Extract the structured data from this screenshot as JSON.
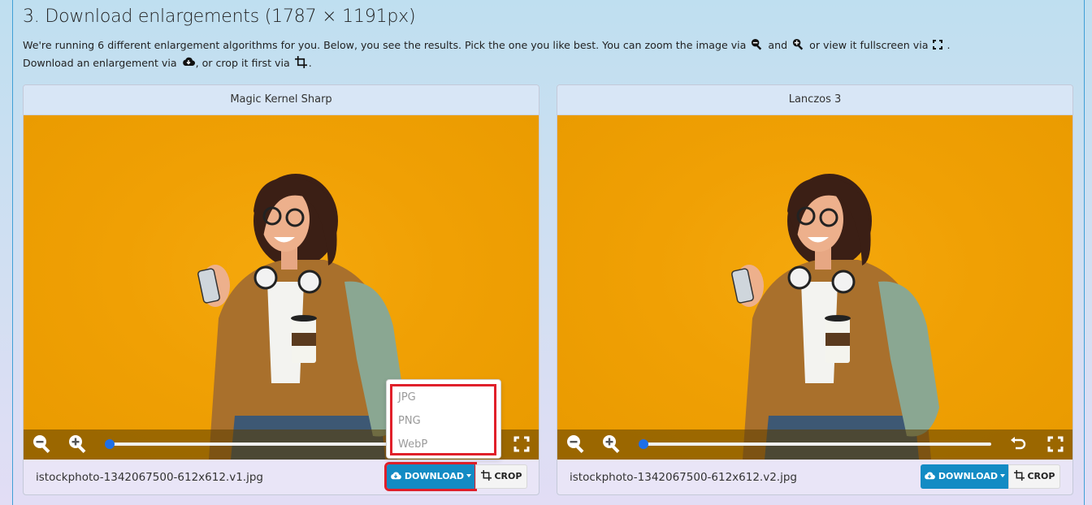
{
  "header": {
    "title": "3. Download enlargements (1787 × 1191px)",
    "desc_1": "We're running 6 different enlargement algorithms for you. Below, you see the results. Pick the one you like best. You can zoom the image via",
    "desc_and": "and",
    "desc_2": "or view it fullscreen via",
    "desc_dot": ".",
    "desc_3": "Download an enlargement via",
    "desc_4": ", or crop it first via",
    "desc_end": "."
  },
  "cards": [
    {
      "title": "Magic Kernel Sharp",
      "filename": "istockphoto-1342067500-612x612.v1.jpg",
      "download_label": "DOWNLOAD",
      "crop_label": "CROP"
    },
    {
      "title": "Lanczos 3",
      "filename": "istockphoto-1342067500-612x612.v2.jpg",
      "download_label": "DOWNLOAD",
      "crop_label": "CROP"
    }
  ],
  "dropdown": {
    "options": [
      "JPG",
      "PNG",
      "WebP"
    ]
  },
  "icons": {
    "zoom_out": "zoom-out-icon",
    "zoom_in": "zoom-in-icon",
    "fullscreen": "fullscreen-icon",
    "reset": "undo-icon",
    "cloud": "cloud-download-icon",
    "crop": "crop-icon"
  },
  "colors": {
    "accent": "#138bc4",
    "highlight": "#e0202a",
    "slider": "#1e6fe8",
    "image_bg": "#f0a004"
  }
}
